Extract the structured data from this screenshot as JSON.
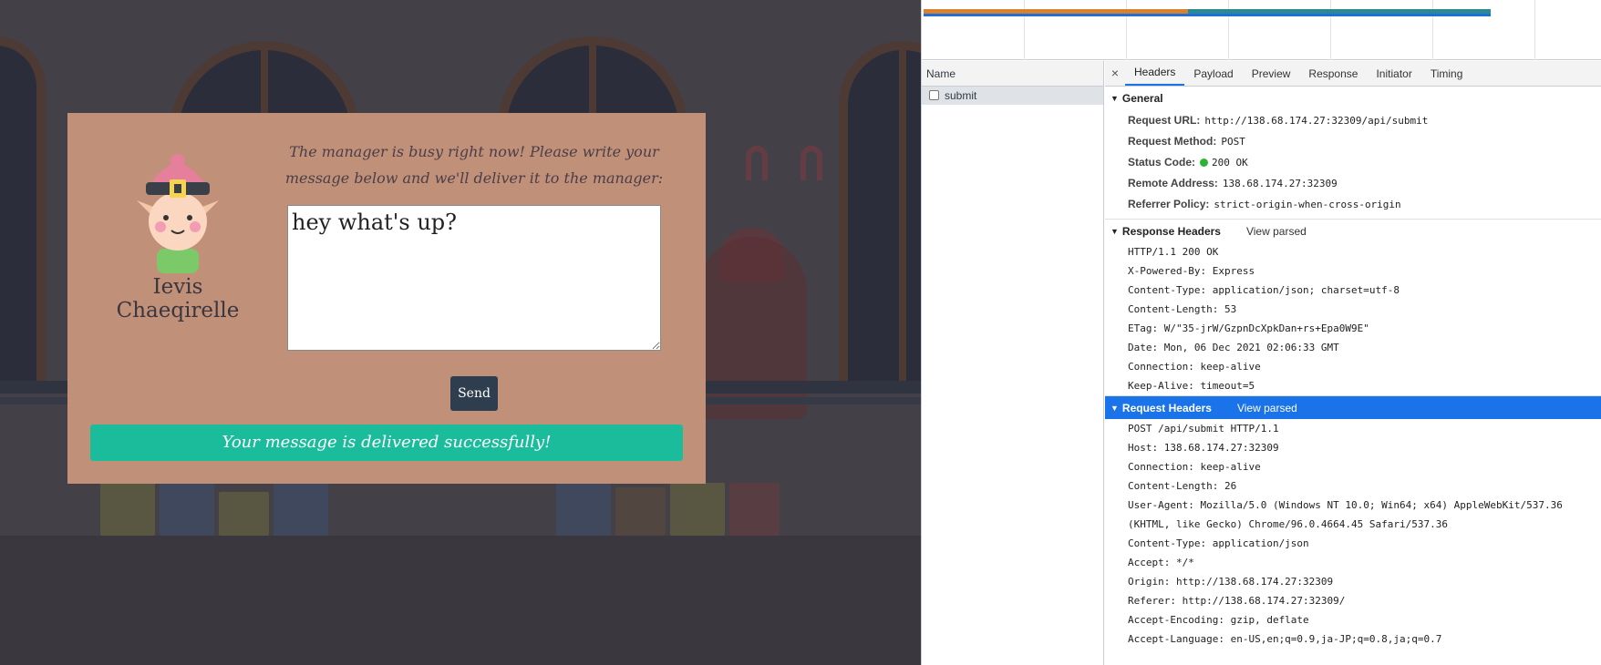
{
  "app": {
    "elf_name": "Ievis Chaeqirelle",
    "prompt": "The manager is busy right now! Please write your message below and we'll deliver it to the manager:",
    "message_value": "hey what's up?",
    "send_label": "Send",
    "success_text": "Your message is delivered successfully!"
  },
  "devtools": {
    "name_header": "Name",
    "request_name": "submit",
    "close_glyph": "×",
    "tabs": [
      "Headers",
      "Payload",
      "Preview",
      "Response",
      "Initiator",
      "Timing"
    ],
    "active_tab": "Headers",
    "general": {
      "title": "General",
      "rows": [
        {
          "key": "Request URL:",
          "value": "http://138.68.174.27:32309/api/submit"
        },
        {
          "key": "Request Method:",
          "value": "POST"
        },
        {
          "key": "Status Code:",
          "value": "200 OK"
        },
        {
          "key": "Remote Address:",
          "value": "138.68.174.27:32309"
        },
        {
          "key": "Referrer Policy:",
          "value": "strict-origin-when-cross-origin"
        }
      ]
    },
    "response_headers": {
      "title": "Response Headers",
      "view_parsed": "View parsed",
      "lines": [
        "HTTP/1.1 200 OK",
        "X-Powered-By: Express",
        "Content-Type: application/json; charset=utf-8",
        "Content-Length: 53",
        "ETag: W/\"35-jrW/GzpnDcXpkDan+rs+Epa0W9E\"",
        "Date: Mon, 06 Dec 2021 02:06:33 GMT",
        "Connection: keep-alive",
        "Keep-Alive: timeout=5"
      ]
    },
    "request_headers": {
      "title": "Request Headers",
      "view_parsed": "View parsed",
      "lines": [
        "POST /api/submit HTTP/1.1",
        "Host: 138.68.174.27:32309",
        "Connection: keep-alive",
        "Content-Length: 26",
        "User-Agent: Mozilla/5.0 (Windows NT 10.0; Win64; x64) AppleWebKit/537.36 (KHTML, like Gecko) Chrome/96.0.4664.45 Safari/537.36",
        "Content-Type: application/json",
        "Accept: */*",
        "Origin: http://138.68.174.27:32309",
        "Referer: http://138.68.174.27:32309/",
        "Accept-Encoding: gzip, deflate",
        "Accept-Language: en-US,en;q=0.9,ja-JP;q=0.8,ja;q=0.7"
      ]
    },
    "colors": {
      "selection": "#1a73e8",
      "status_dot": "#2bb534",
      "success_banner": "#1abc9c",
      "card": "#c09078"
    }
  }
}
